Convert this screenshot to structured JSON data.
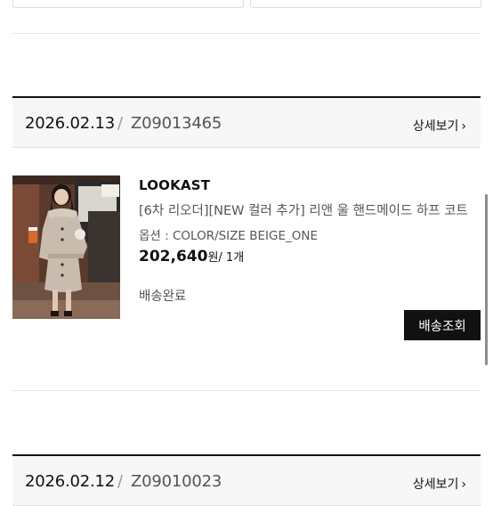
{
  "orders": [
    {
      "date": "2026.02.13",
      "separator": "/",
      "order_no": "Z09013465",
      "detail_label": "상세보기",
      "item": {
        "brand": "LOOKAST",
        "name": "[6차 리오더][NEW 컬러 추가] 리앤 울 핸드메이드 하프 코트",
        "option": "옵션 : COLOR/SIZE BEIGE_ONE",
        "price": "202,640",
        "currency": "원",
        "qty": "/ 1개",
        "status": "배송완료",
        "track_label": "배송조회"
      }
    },
    {
      "date": "2026.02.12",
      "separator": "/",
      "order_no": "Z09010023",
      "detail_label": "상세보기"
    }
  ],
  "colors": {
    "primary_button": "#111111",
    "header_bg": "#f7f7f7",
    "divider": "#e5e5e5"
  },
  "icons": {
    "detail": "chevron-right-icon"
  }
}
